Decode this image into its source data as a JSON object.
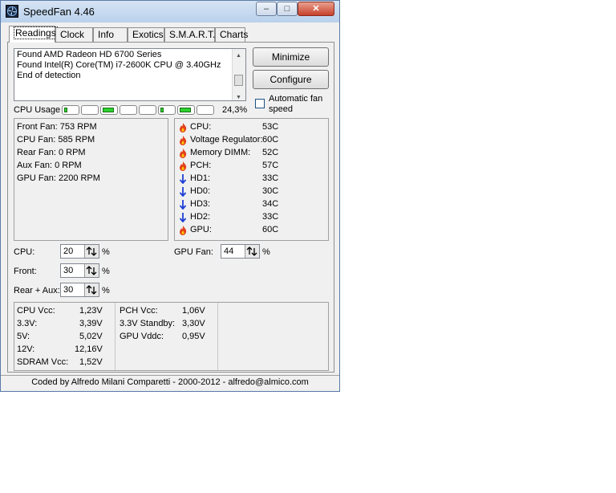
{
  "window": {
    "title": "SpeedFan 4.46",
    "minimize_glyph": "–",
    "maximize_glyph": "□",
    "close_glyph": "✕"
  },
  "tabs": [
    "Readings",
    "Clock",
    "Info",
    "Exotics",
    "S.M.A.R.T.",
    "Charts"
  ],
  "log": [
    "Found AMD Radeon HD 6700 Series",
    "Found Intel(R) Core(TM) i7-2600K CPU @ 3.40GHz",
    "End of detection"
  ],
  "buttons": {
    "minimize": "Minimize",
    "configure": "Configure"
  },
  "auto_fan": {
    "label": "Automatic fan speed",
    "checked": false
  },
  "cpu_usage": {
    "label": "CPU Usage",
    "total": "24,3%",
    "cores": [
      0.25,
      0.0,
      0.85,
      0.0,
      0.0,
      0.2,
      0.85,
      0.0
    ]
  },
  "fans": [
    "Front Fan: 753 RPM",
    "CPU Fan: 585 RPM",
    "Rear Fan: 0 RPM",
    "Aux Fan:  0 RPM",
    "GPU Fan: 2200 RPM"
  ],
  "temps": [
    {
      "label": "CPU:",
      "value": "53C",
      "icon": "flame-icon"
    },
    {
      "label": "Voltage Regulator:",
      "value": "60C",
      "icon": "flame-icon"
    },
    {
      "label": "Memory DIMM:",
      "value": "52C",
      "icon": "flame-icon"
    },
    {
      "label": "PCH:",
      "value": "57C",
      "icon": "flame-icon"
    },
    {
      "label": "HD1:",
      "value": "33C",
      "icon": "arrow-down-icon"
    },
    {
      "label": "HD0:",
      "value": "30C",
      "icon": "arrow-down-icon"
    },
    {
      "label": "HD3:",
      "value": "34C",
      "icon": "arrow-down-icon"
    },
    {
      "label": "HD2:",
      "value": "33C",
      "icon": "arrow-down-icon"
    },
    {
      "label": "GPU:",
      "value": "60C",
      "icon": "flame-icon"
    }
  ],
  "speeds": {
    "cpu": {
      "label": "CPU:",
      "value": "20"
    },
    "front": {
      "label": "Front:",
      "value": "30"
    },
    "rear_aux": {
      "label": "Rear + Aux:",
      "value": "30"
    },
    "gpu_fan": {
      "label": "GPU Fan:",
      "value": "44"
    },
    "unit": "%"
  },
  "voltages_left": [
    {
      "label": "CPU Vcc:",
      "value": "1,23V"
    },
    {
      "label": "3.3V:",
      "value": "3,39V"
    },
    {
      "label": "5V:",
      "value": "5,02V"
    },
    {
      "label": "12V:",
      "value": "12,16V"
    },
    {
      "label": "SDRAM Vcc:",
      "value": "1,52V"
    }
  ],
  "voltages_right": [
    {
      "label": "PCH Vcc:",
      "value": "1,06V"
    },
    {
      "label": "3.3V Standby:",
      "value": "3,30V"
    },
    {
      "label": "GPU Vddc:",
      "value": "0,95V"
    }
  ],
  "status": "Coded by Alfredo Milani Comparetti - 2000-2012 - alfredo@almico.com"
}
